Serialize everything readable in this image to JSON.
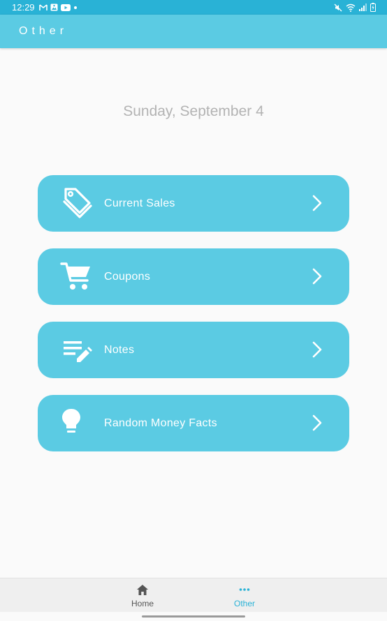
{
  "status_bar": {
    "time": "12:29",
    "background": "#29b2d6",
    "left_icons": [
      "gmail-icon",
      "image-notification-icon",
      "youtube-icon",
      "more-notifications-dot-icon"
    ],
    "right_icons": [
      "mute-icon",
      "wifi-icon",
      "cellular-signal-icon",
      "battery-charging-icon"
    ]
  },
  "app_bar": {
    "title": "Other",
    "background": "#5bcbe3"
  },
  "date": {
    "text": "Sunday, September 4",
    "color": "#b3b3b3"
  },
  "menu": {
    "card_color": "#5bcbe3",
    "items": [
      {
        "label": "Current Sales",
        "icon": "price-tags-icon"
      },
      {
        "label": "Coupons",
        "icon": "shopping-cart-icon"
      },
      {
        "label": "Notes",
        "icon": "notes-edit-icon"
      },
      {
        "label": "Random Money Facts",
        "icon": "lightbulb-icon"
      }
    ]
  },
  "bottom_nav": {
    "items": [
      {
        "label": "Home",
        "icon": "home-icon",
        "active": false
      },
      {
        "label": "Other",
        "icon": "more-dots-icon",
        "active": true
      }
    ],
    "active_color": "#29b2d6",
    "inactive_color": "#555555"
  }
}
